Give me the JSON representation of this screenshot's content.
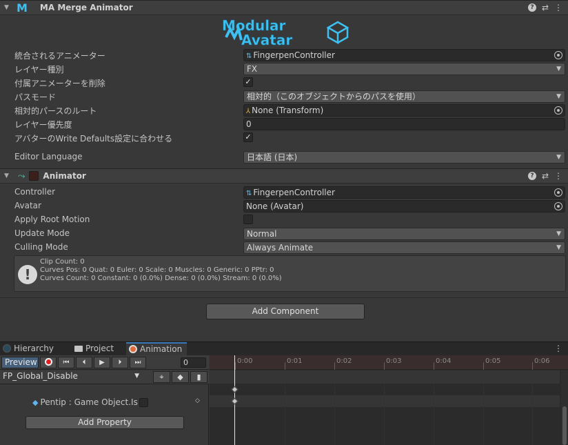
{
  "ma_component": {
    "title": "MA Merge Animator",
    "logo_line1": "Modular",
    "logo_line2": "Avatar",
    "fields": {
      "animator_label": "統合されるアニメーター",
      "animator_value": "FingerpenController",
      "layer_type_label": "レイヤー種別",
      "layer_type_value": "FX",
      "delete_attached_label": "付属アニメーターを削除",
      "path_mode_label": "パスモード",
      "path_mode_value": "相対的（このオブジェクトからのパスを使用）",
      "relative_root_label": "相対的パースのルート",
      "relative_root_value": "None (Transform)",
      "layer_priority_label": "レイヤー優先度",
      "layer_priority_value": "0",
      "match_wd_label": "アバターのWrite Defaults設定に合わせる",
      "editor_language_label": "Editor Language",
      "editor_language_value": "日本語 (日本)"
    }
  },
  "animator_component": {
    "title": "Animator",
    "controller_label": "Controller",
    "controller_value": "FingerpenController",
    "avatar_label": "Avatar",
    "avatar_value": "None (Avatar)",
    "apply_root_motion_label": "Apply Root Motion",
    "update_mode_label": "Update Mode",
    "update_mode_value": "Normal",
    "culling_mode_label": "Culling Mode",
    "culling_mode_value": "Always Animate",
    "info_lines": [
      "Clip Count: 0",
      "Curves Pos: 0 Quat: 0 Euler: 0 Scale: 0 Muscles: 0 Generic: 0 PPtr: 0",
      "Curves Count: 0 Constant: 0 (0.0%) Dense: 0 (0.0%) Stream: 0 (0.0%)"
    ]
  },
  "add_component_label": "Add Component",
  "tabs": {
    "hierarchy": "Hierarchy",
    "project": "Project",
    "animation": "Animation"
  },
  "animation": {
    "preview_label": "Preview",
    "frame_value": "0",
    "clip_name": "FP_Global_Disable",
    "property_label": "Pentip : Game Object.Is A",
    "add_property_label": "Add Property",
    "ticks": [
      "0:00",
      "0:01",
      "0:02",
      "0:03",
      "0:04",
      "0:05",
      "0:06"
    ]
  },
  "colors": {
    "accent_tab": "#3a79bb",
    "record": "#e02020",
    "logo_blue": "#3ec0f0"
  }
}
